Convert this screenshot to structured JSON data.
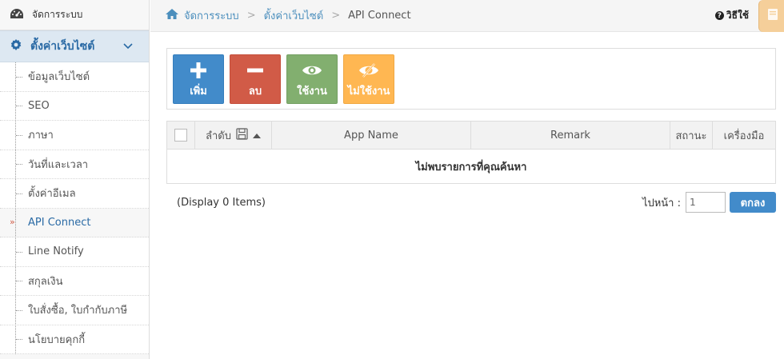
{
  "sidebar": {
    "top_label": "จัดการระบบ",
    "active_label": "ตั้งค่าเว็บไซต์",
    "items": [
      {
        "label": "ข้อมูลเว็บไซต์"
      },
      {
        "label": "SEO"
      },
      {
        "label": "ภาษา"
      },
      {
        "label": "วันที่และเวลา"
      },
      {
        "label": "ตั้งค่าอีเมล"
      },
      {
        "label": "API Connect"
      },
      {
        "label": "Line Notify"
      },
      {
        "label": "สกุลเงิน"
      },
      {
        "label": "ใบสั่งซื้อ, ใบกำกับภาษี"
      },
      {
        "label": "นโยบายคุกกี้"
      }
    ],
    "current_marker": "»"
  },
  "breadcrumb": {
    "home": "จัดการระบบ",
    "section": "ตั้งค่าเว็บไซต์",
    "current": "API Connect",
    "separator": ">"
  },
  "help": {
    "label": "วิธีใช้"
  },
  "toolbar": {
    "add": "เพิ่ม",
    "delete": "ลบ",
    "enable": "ใช้งาน",
    "disable": "ไม่ใช้งาน"
  },
  "table": {
    "columns": [
      "ลำดับ",
      "App Name",
      "Remark",
      "สถานะ",
      "เครื่องมือ"
    ],
    "empty_message": "ไม่พบรายการที่คุณค้นหา"
  },
  "footer": {
    "display": "(Display 0 Items)",
    "goto_label": "ไปหน้า :",
    "page_value": "1",
    "go_button": "ตกลง"
  },
  "colors": {
    "primary": "#428bca",
    "danger": "#d15b47",
    "success": "#82af6f",
    "warning": "#ffb752"
  }
}
